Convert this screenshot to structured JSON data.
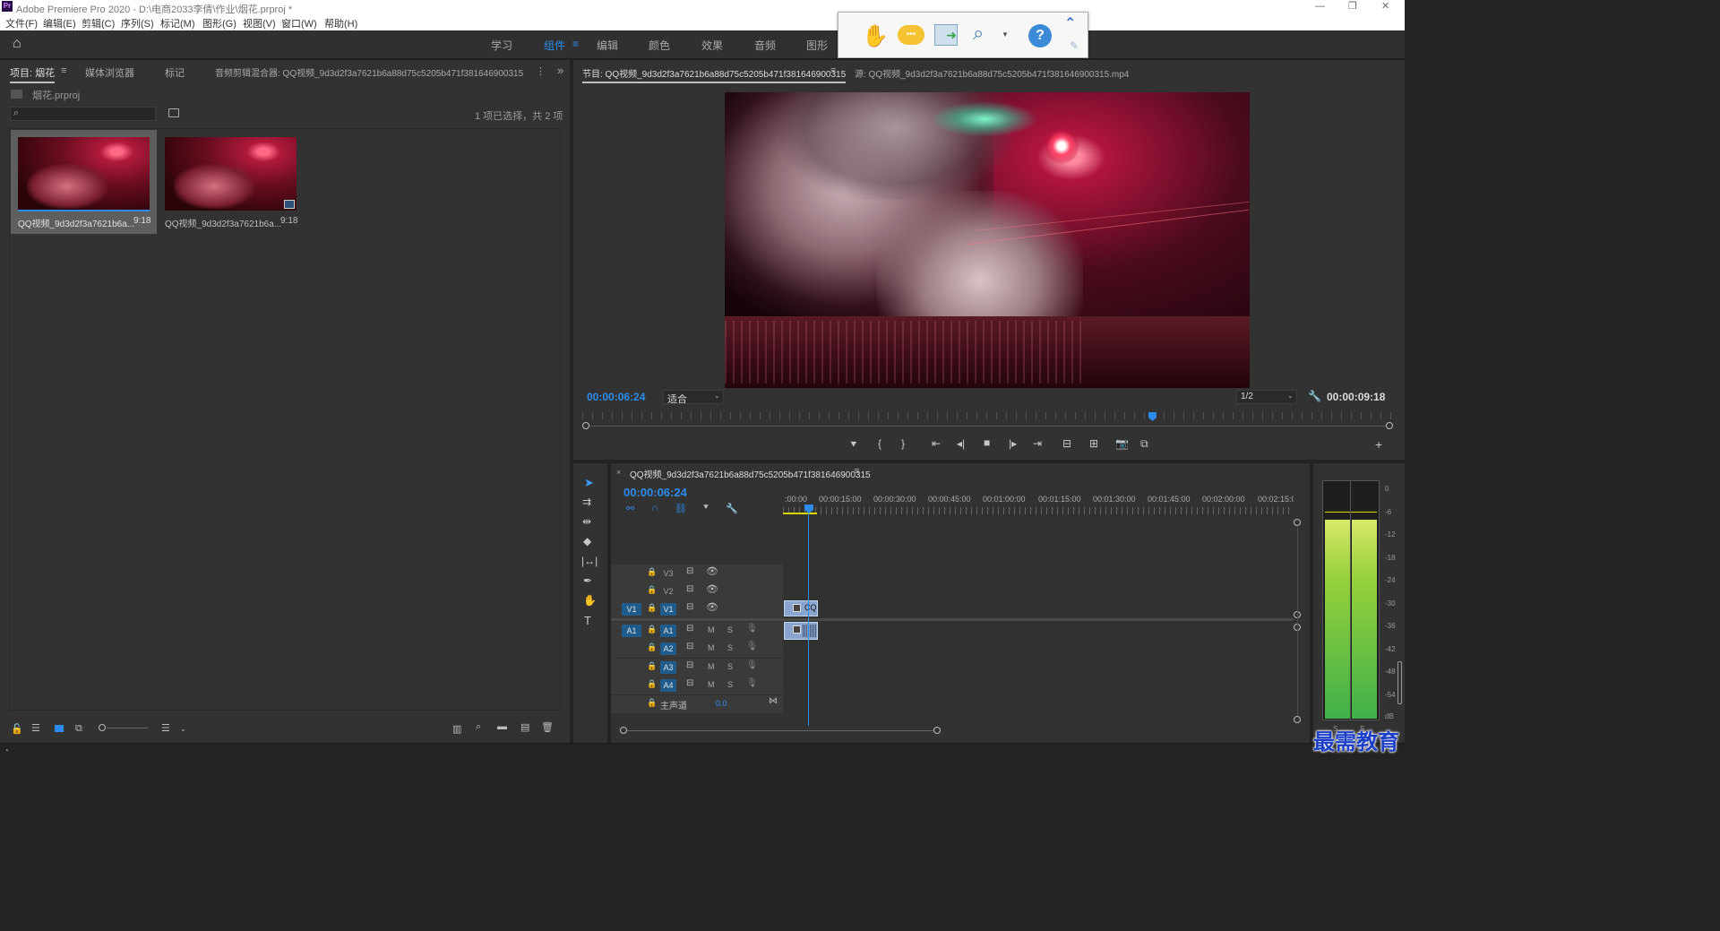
{
  "app": {
    "title": "Adobe Premiere Pro 2020 - D:\\电商2033李倩\\作业\\烟花.prproj *",
    "icon_text": "Pr"
  },
  "menu": [
    "文件(F)",
    "编辑(E)",
    "剪辑(C)",
    "序列(S)",
    "标记(M)",
    "图形(G)",
    "视图(V)",
    "窗口(W)",
    "帮助(H)"
  ],
  "workspaces": [
    "学习",
    "组件",
    "编辑",
    "颜色",
    "效果",
    "音频",
    "图形"
  ],
  "project": {
    "tabs": [
      "项目: 烟花",
      "媒体浏览器",
      "标记",
      "音频剪辑混合器: QQ视频_9d3d2f3a7621b6a88d75c5205b471f381646900315"
    ],
    "file": "烟花.prproj",
    "selection_info": "1 项已选择，共 2 项",
    "items": [
      {
        "name": "QQ视频_9d3d2f3a7621b6a...",
        "duration": "9:18"
      },
      {
        "name": "QQ视频_9d3d2f3a7621b6a...",
        "duration": "9:18"
      }
    ]
  },
  "program": {
    "tab": "节目: QQ视频_9d3d2f3a7621b6a88d75c5205b471f381646900315",
    "source_tab": "源: QQ视频_9d3d2f3a7621b6a88d75c5205b471f381646900315.mp4",
    "timecode": "00:00:06:24",
    "fit": "适合",
    "quality": "1/2",
    "duration": "00:00:09:18",
    "playhead_fraction": 0.71
  },
  "timeline": {
    "tab": "QQ视频_9d3d2f3a7621b6a88d75c5205b471f381646900315",
    "timecode": "00:00:06:24",
    "ruler": [
      ":00:00",
      "00:00:15:00",
      "00:00:30:00",
      "00:00:45:00",
      "00:01:00:00",
      "00:01:15:00",
      "00:01:30:00",
      "00:01:45:00",
      "00:02:00:00",
      "00:02:15:0"
    ],
    "video_tracks": [
      "V3",
      "V2",
      "V1"
    ],
    "audio_tracks": [
      "A1",
      "A2",
      "A3",
      "A4"
    ],
    "src_v": "V1",
    "src_a": "A1",
    "mute": "M",
    "solo": "S",
    "master_label": "主声道",
    "master_value": "0.0",
    "clip_label": "CQ"
  },
  "vu_meter": {
    "scale": [
      "0",
      "-6",
      "-12",
      "-18",
      "-24",
      "-30",
      "-36",
      "-42",
      "-48",
      "-54",
      "dB"
    ],
    "unit_marks": [
      "S",
      "S"
    ]
  },
  "watermark": "最需教育",
  "colors": {
    "accent": "#2d8ceb",
    "panel": "#323232",
    "clip": "#8aa6d0",
    "meter_green": "#7ec834"
  }
}
